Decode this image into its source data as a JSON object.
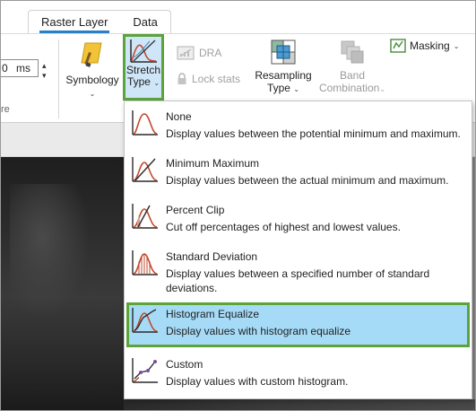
{
  "tabs": [
    {
      "label": "Raster Layer",
      "active": true
    },
    {
      "label": "Data",
      "active": false
    }
  ],
  "ribbon": {
    "ms_value": "0",
    "ms_unit": "ms",
    "group_tail": "re",
    "symbology": {
      "label": "Symbology",
      "caret": "⌄"
    },
    "stretch_type": {
      "line1": "Stretch",
      "line2": "Type",
      "caret": "⌄"
    },
    "dra": {
      "label": "DRA"
    },
    "lock_stats": {
      "label": "Lock stats"
    },
    "resampling_type": {
      "line1": "Resampling",
      "line2": "Type",
      "caret": "⌄"
    },
    "band_combination": {
      "line1": "Band",
      "line2": "Combination",
      "caret": "⌄"
    },
    "masking": {
      "label": "Masking",
      "caret": "⌄"
    }
  },
  "stretch_menu": {
    "items": [
      {
        "title": "None",
        "description": "Display values between the potential minimum and maximum.",
        "selected": false
      },
      {
        "title": "Minimum Maximum",
        "description": "Display values between the actual minimum and maximum.",
        "selected": false
      },
      {
        "title": "Percent Clip",
        "description": "Cut off percentages of highest and lowest values.",
        "selected": false
      },
      {
        "title": "Standard Deviation",
        "description": "Display values between a specified number of standard deviations.",
        "selected": false
      },
      {
        "title": "Histogram Equalize",
        "description": "Display values with histogram equalize",
        "selected": true
      },
      {
        "title": "Custom",
        "description": "Display values with custom histogram.",
        "selected": false
      }
    ]
  },
  "colors": {
    "highlight_border": "#5ca33a",
    "selected_background": "#a6dbf7",
    "tab_underline": "#2b7fc4"
  }
}
